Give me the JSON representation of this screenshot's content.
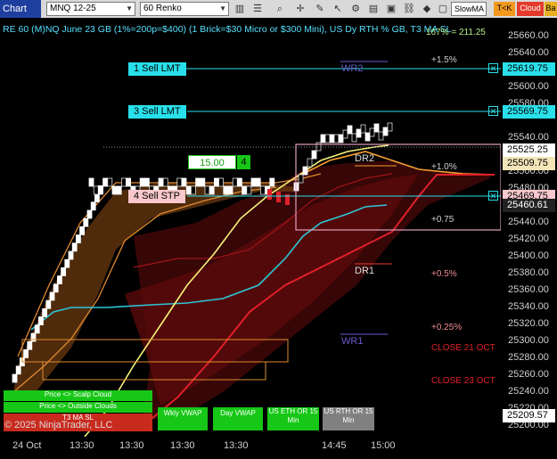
{
  "toolbar": {
    "window_title": "Chart",
    "instrument": "MNQ 12-25",
    "bar_type": "60 Renko",
    "strategy_label": "SlowMA",
    "tk_label": "T<K",
    "cloud_label": "Cloud",
    "ba_label": "Ba"
  },
  "header": {
    "title": "RE 60 (M)NQ June 23 GB (1%=200p=$400) (1 Brick=$30 Micro or $300 Mini), US Dy RTH % GB, T3 MA SL",
    "overlay_tag": "167% = 211.25"
  },
  "orders": [
    {
      "label": "1 Sell LMT",
      "price": "25619.75"
    },
    {
      "label": "3 Sell LMT",
      "price": "25569.75"
    },
    {
      "label": "4 Sell STP",
      "price": "25469.75"
    }
  ],
  "position": {
    "pnl": "15.00",
    "qty": "4"
  },
  "levels": {
    "wr2": "WR2",
    "dr2": "DR2",
    "dr1": "DR1",
    "wr1": "WR1",
    "pct_1_5": "+1.5%",
    "pct_1_0": "+1.0%",
    "pct_0_75": "+0.75",
    "pct_0_5": "+0.5%",
    "pct_0_25": "+0.25%",
    "close_21": "CLOSE 21 OCT",
    "close_23": "CLOSE 23 OCT"
  },
  "price_axis": {
    "labels": [
      "25660.00",
      "25640.00",
      "25600.00",
      "25580.00",
      "25540.00",
      "25520.00",
      "25500.00",
      "25480.00",
      "25440.00",
      "25420.00",
      "25400.00",
      "25380.00",
      "25360.00",
      "25340.00",
      "25320.00",
      "25300.00",
      "25280.00",
      "25260.00",
      "25240.00",
      "25220.00",
      "25200.00"
    ],
    "tags": {
      "sell1": "25619.75",
      "sell3": "25569.75",
      "last": "25525.25",
      "mid": "25509.75",
      "stop": "25469.75",
      "dark": "25460.61",
      "bottom": "25209.57"
    }
  },
  "time_axis": [
    "24 Oct",
    "13:30",
    "13:30",
    "13:30",
    "13:30",
    "14:45",
    "15:00"
  ],
  "legend_buttons": {
    "scalp": "Price <> Scalp Cloud",
    "outside": "Price <> Outside Clouds",
    "t3": "T3 MA SL",
    "wkly_vwap": "Wkly VWAP",
    "day_vwap": "Day VWAP",
    "us_eth": "US ETH OR 15 Min",
    "us_rth": "US RTH OR 15 Min"
  },
  "copyright": "© 2025 NinjaTrader, LLC",
  "colors": {
    "accent": "#28e0ea",
    "green": "#17c717",
    "red": "#e0202a",
    "orange": "#f5a030",
    "yellow": "#f6f27a"
  }
}
